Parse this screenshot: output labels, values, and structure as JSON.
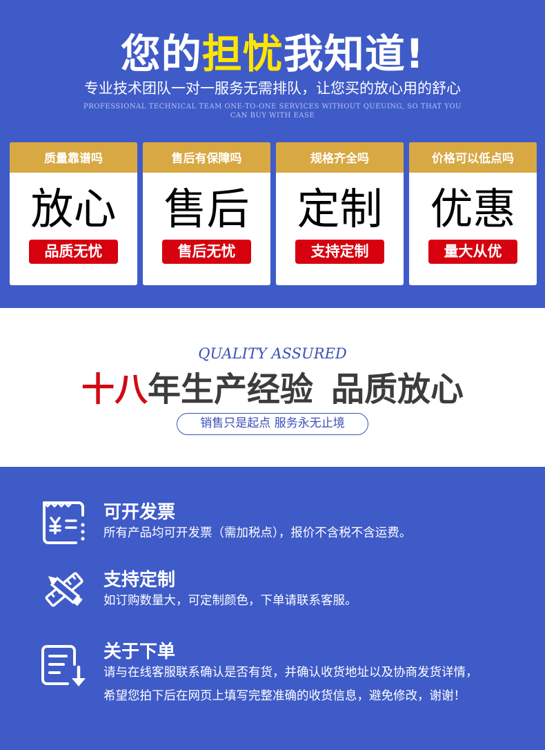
{
  "hero": {
    "headline_pre": "您的",
    "headline_highlight": "担忧",
    "headline_post": "我知道!",
    "subtitle": "专业技术团队一对一服务无需排队，让您买的放心用的舒心",
    "subtitle_en": "PROFESSIONAL TECHNICAL TEAM ONE-TO-ONE SERVICES WITHOUT QUEUING, SO THAT YOU CAN BUY WITH EASE"
  },
  "cards": [
    {
      "question": "质量靠谱吗",
      "big": "放心",
      "tag": "品质无忧"
    },
    {
      "question": "售后有保障吗",
      "big": "售后",
      "tag": "售后无忧"
    },
    {
      "question": "规格齐全吗",
      "big": "定制",
      "tag": "支持定制"
    },
    {
      "question": "价格可以低点吗",
      "big": "优惠",
      "tag": "量大从优"
    }
  ],
  "quality": {
    "en": "QUALITY ASSURED",
    "title_red": "十八",
    "title_main": "年生产经验",
    "title_tail": "品质放心",
    "pill": "销售只是起点 服务永无止境"
  },
  "services": [
    {
      "icon": "invoice-icon",
      "title": "可开发票",
      "desc": [
        "所有产品均可开发票（需加税点），报价不含税不含运费。"
      ]
    },
    {
      "icon": "pencil-ruler-icon",
      "title": "支持定制",
      "desc": [
        "如订购数量大，可定制颜色，下单请联系客服。"
      ]
    },
    {
      "icon": "order-document-icon",
      "title": "关于下单",
      "desc": [
        "请与在线客服联系确认是否有货，并确认收货地址以及协商发货详情，",
        "希望您拍下后在网页上填写完整准确的收货信息，避免修改，谢谢！"
      ]
    }
  ],
  "colors": {
    "brand_blue": "#3f5bc8",
    "gold": "#d8a843",
    "red": "#d6000f",
    "yellow": "#ffe600"
  }
}
